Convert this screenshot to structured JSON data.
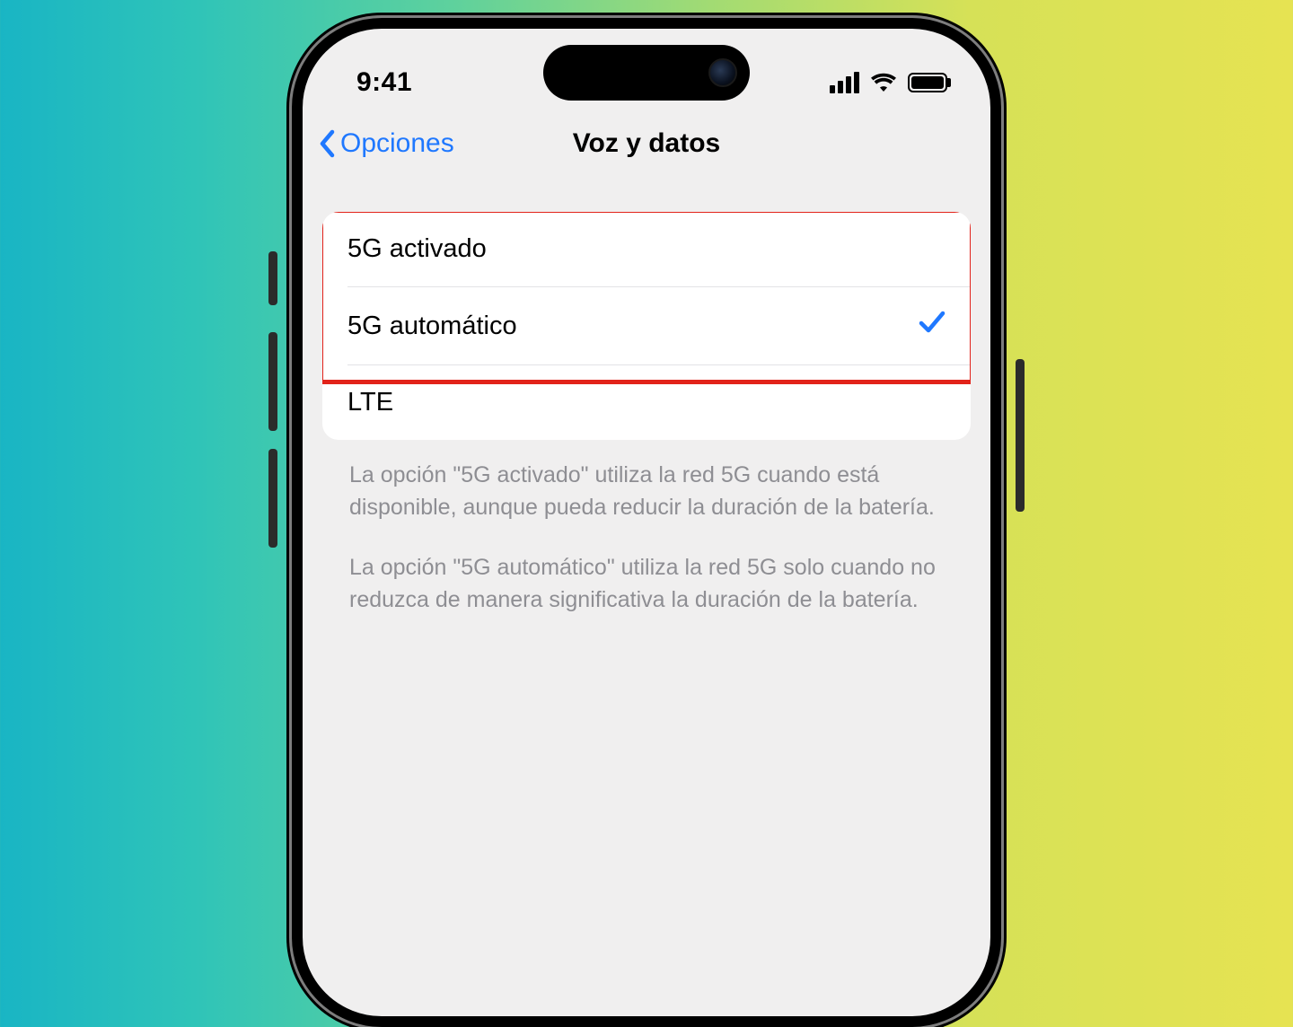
{
  "statusbar": {
    "time": "9:41"
  },
  "nav": {
    "back_label": "Opciones",
    "title": "Voz y datos"
  },
  "options": {
    "items": [
      {
        "label": "5G activado",
        "selected": false
      },
      {
        "label": "5G automático",
        "selected": true
      },
      {
        "label": "LTE",
        "selected": false
      }
    ]
  },
  "footer": {
    "p1": "La opción \"5G activado\" utiliza la red 5G cuando está disponible, aunque pueda reducir la duración de la batería.",
    "p2": "La opción \"5G automático\" utiliza la red 5G solo cuando no reduzca de manera significativa la duración de la batería."
  },
  "annotation": {
    "highlight_color": "#e2231a"
  }
}
